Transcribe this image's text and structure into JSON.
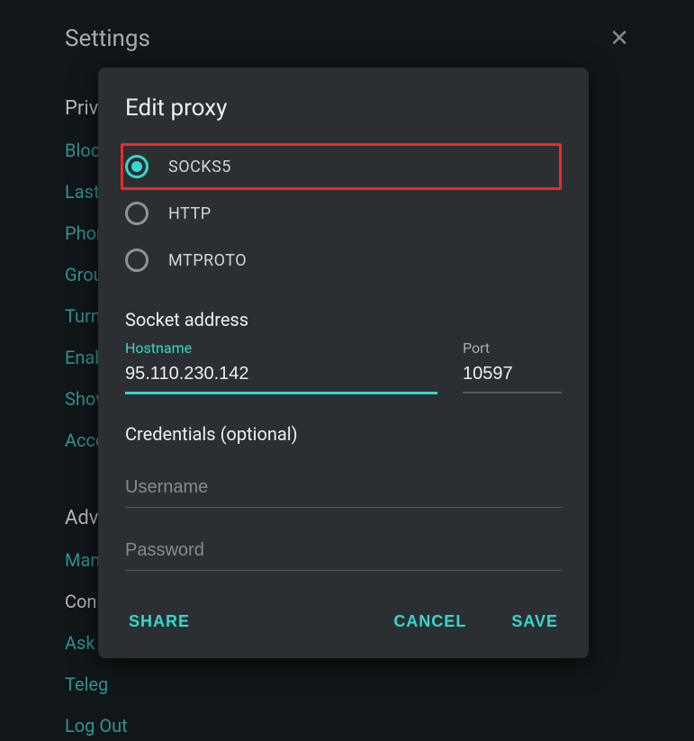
{
  "settings": {
    "title": "Settings",
    "sections": [
      {
        "header": "Priva",
        "items": [
          "Bloc",
          "Last",
          "Phor",
          "Grou",
          "Turn",
          "Enab",
          "Show",
          "Acco"
        ]
      },
      {
        "header": "Adva",
        "items_mixed": [
          {
            "text": "Man",
            "link": true
          },
          {
            "text": "Conr",
            "link": false
          },
          {
            "text": "Ask a",
            "link": true
          },
          {
            "text": "Teleg",
            "link": true
          },
          {
            "text": "Log Out",
            "link": true
          }
        ]
      }
    ]
  },
  "dialog": {
    "title": "Edit proxy",
    "protocols": [
      {
        "label": "SOCKS5",
        "selected": true,
        "highlighted": true
      },
      {
        "label": "HTTP",
        "selected": false,
        "highlighted": false
      },
      {
        "label": "MTPROTO",
        "selected": false,
        "highlighted": false
      }
    ],
    "socket_section_label": "Socket address",
    "hostname_label": "Hostname",
    "hostname_value": "95.110.230.142",
    "port_label": "Port",
    "port_value": "10597",
    "credentials_section_label": "Credentials (optional)",
    "username_placeholder": "Username",
    "username_value": "",
    "password_placeholder": "Password",
    "password_value": "",
    "share_label": "SHARE",
    "cancel_label": "CANCEL",
    "save_label": "SAVE"
  }
}
